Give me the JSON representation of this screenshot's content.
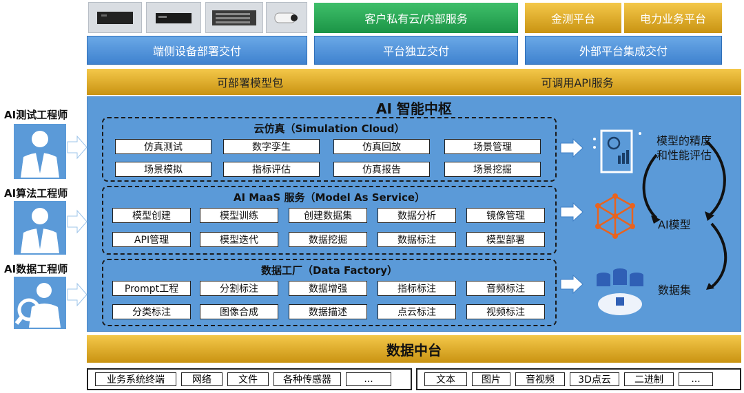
{
  "delivery": {
    "client_cloud": "客户私有云/内部服务",
    "jince": "金测平台",
    "power": "电力业务平台",
    "edge": "端侧设备部署交付",
    "platform": "平台独立交付",
    "external": "外部平台集成交付"
  },
  "packages": {
    "model_pkg": "可部署模型包",
    "api_service": "可调用API服务"
  },
  "hub_title": "AI 智能中枢",
  "roles": [
    "AI测试工程师",
    "AI算法工程师",
    "AI数据工程师"
  ],
  "simulation": {
    "title": "云仿真（Simulation Cloud）",
    "row1": [
      "仿真测试",
      "数字孪生",
      "仿真回放",
      "场景管理"
    ],
    "row2": [
      "场景模拟",
      "指标评估",
      "仿真报告",
      "场景挖掘"
    ]
  },
  "maas": {
    "title": "AI MaaS 服务（Model As Service）",
    "row1": [
      "模型创建",
      "模型训练",
      "创建数据集",
      "数据分析",
      "镜像管理"
    ],
    "row2": [
      "API管理",
      "模型迭代",
      "数据挖掘",
      "数据标注",
      "模型部署"
    ]
  },
  "factory": {
    "title": "数据工厂（Data Factory）",
    "row1": [
      "Prompt工程",
      "分割标注",
      "数据增强",
      "指标标注",
      "音频标注"
    ],
    "row2": [
      "分类标注",
      "图像合成",
      "数据描述",
      "点云标注",
      "视频标注"
    ]
  },
  "outputs": {
    "eval": "模型的精度和性能评估",
    "model": "AI模型",
    "dataset": "数据集"
  },
  "data_center": "数据中台",
  "sources_left": [
    "业务系统终端",
    "网络",
    "文件",
    "各种传感器",
    "..."
  ],
  "sources_right": [
    "文本",
    "图片",
    "音视频",
    "3D点云",
    "二进制",
    "..."
  ]
}
